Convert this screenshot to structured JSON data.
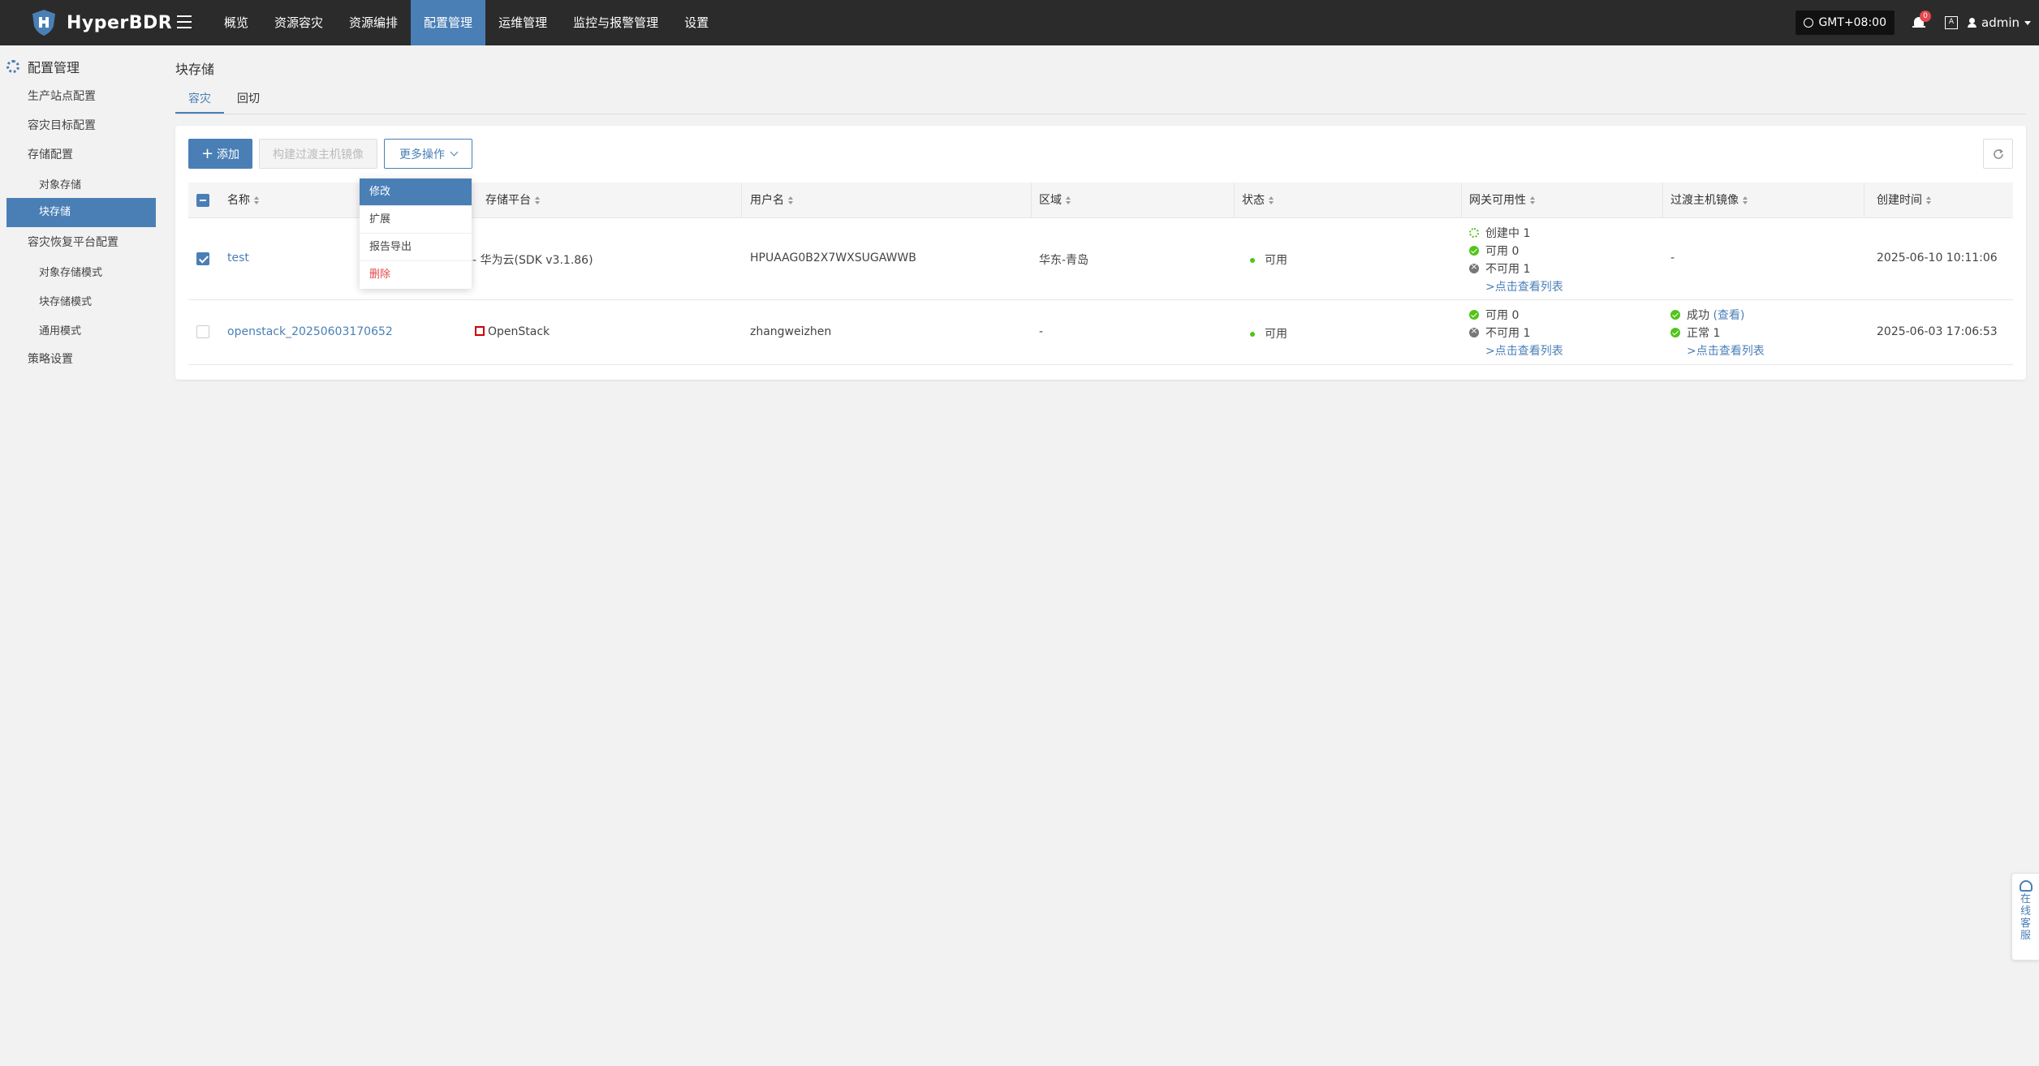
{
  "app": {
    "name": "HyperBDR"
  },
  "nav": [
    "概览",
    "资源容灾",
    "资源编排",
    "配置管理",
    "运维管理",
    "监控与报警管理",
    "设置"
  ],
  "header": {
    "timezone": "GMT+08:00",
    "notifications": "0",
    "language_icon": "A",
    "user": "admin"
  },
  "sidebar": {
    "title": "配置管理",
    "items": [
      "生产站点配置",
      "容灾目标配置",
      "存储配置",
      "对象存储",
      "块存储",
      "容灾恢复平台配置",
      "对象存储模式",
      "块存储模式",
      "通用模式",
      "策略设置"
    ]
  },
  "page": {
    "title": "块存储",
    "tabs": [
      "容灾",
      "回切"
    ]
  },
  "toolbar": {
    "add": "添加",
    "build_image": "构建过渡主机镜像",
    "more_actions": "更多操作"
  },
  "dropdown": [
    "修改",
    "扩展",
    "报告导出",
    "删除"
  ],
  "table": {
    "columns": [
      "名称",
      "存储平台",
      "用户名",
      "区域",
      "状态",
      "网关可用性",
      "过渡主机镜像",
      "创建时间"
    ],
    "rows": [
      {
        "name": "test",
        "platform": "华为云(SDK v3.1.86)",
        "username": "HPUAAG0B2X7WXSUGAWWB",
        "region": "华东-青岛",
        "status": "可用",
        "gateway": {
          "creating": "创建中 1",
          "ok": "可用 0",
          "bad": "不可用 1",
          "link": ">点击查看列表"
        },
        "image": "-",
        "created": "2025-06-10 10:11:06",
        "checked": true
      },
      {
        "name": "openstack_20250603170652",
        "platform": "OpenStack",
        "username": "zhangweizhen",
        "region": "-",
        "status": "可用",
        "gateway": {
          "ok": "可用 0",
          "bad": "不可用 1",
          "link": ">点击查看列表"
        },
        "image": {
          "success": "成功",
          "view": "(查看)",
          "normal": "正常 1",
          "link": ">点击查看列表"
        },
        "created": "2025-06-03 17:06:53",
        "checked": false
      }
    ]
  },
  "service": {
    "label": "在线客服"
  },
  "colors": {
    "accent": "#4a7fb6",
    "topbar": "#2b2b2b",
    "success": "#52c41a",
    "danger": "#e5484d"
  }
}
